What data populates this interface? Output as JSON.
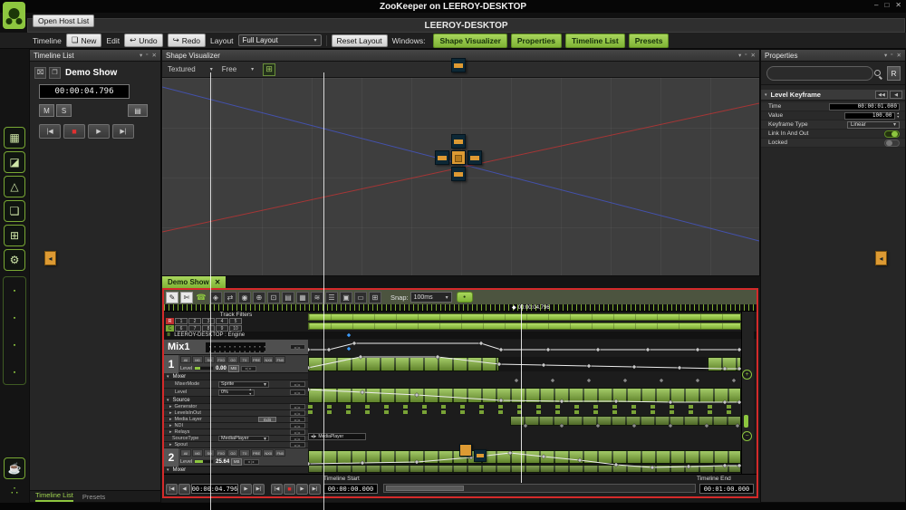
{
  "window": {
    "title": "ZooKeeper on LEEROY-DESKTOP",
    "minimize": "–",
    "maximize": "□",
    "close": "✕"
  },
  "chrome": {
    "menu": "▾",
    "pin": "▫",
    "close": "✕"
  },
  "glyphs": {
    "collapse": "▾",
    "expand": "▸",
    "caret": "▾",
    "diamond": "◆",
    "plus": "+",
    "minus": "−",
    "nav": "◂|▸",
    "engine": "≣",
    "new_doc": "❏",
    "undo": "↩",
    "redo": "↪",
    "grid": "⊞",
    "options": "▤",
    "delete": "⌧",
    "duplicate": "❐",
    "snap_dot": "●",
    "spin_up": "▲",
    "spin_down": "▼",
    "chip_arrow": "◂"
  },
  "host": {
    "open_host_list": "Open Host List",
    "name": "LEEROY-DESKTOP"
  },
  "toolbar": {
    "timeline_menu": "Timeline",
    "new": "New",
    "edit": "Edit",
    "undo": "Undo",
    "redo": "Redo",
    "layout_label": "Layout",
    "layout_value": "Full Layout",
    "reset_layout": "Reset Layout",
    "windows_label": "Windows:",
    "window_buttons": [
      "Shape Visualizer",
      "Properties",
      "Timeline List",
      "Presets"
    ]
  },
  "sidebar": {
    "top_icons": [
      {
        "name": "media-manager-icon",
        "glyph": "▦"
      },
      {
        "name": "output-manager-icon",
        "glyph": "◪"
      },
      {
        "name": "shape-editor-icon",
        "glyph": "△"
      },
      {
        "name": "tags-icon",
        "glyph": "❏"
      },
      {
        "name": "pixelmapper-icon",
        "glyph": "⊞"
      },
      {
        "name": "component-settings-icon",
        "glyph": "⚙"
      }
    ],
    "slots": [
      {
        "glyph": "▪"
      },
      {
        "glyph": "▪"
      },
      {
        "glyph": "▪"
      },
      {
        "glyph": "▪"
      }
    ],
    "cup": "☕",
    "network": "∴"
  },
  "timeline_list": {
    "title": "Timeline List",
    "show_name": "Demo Show",
    "timecode": "00:00:04.796",
    "mute": "M",
    "solo": "S",
    "transport": {
      "skip_back": "|◀",
      "stop": "■",
      "play": "▶",
      "skip_fwd": "▶|"
    },
    "tab_active": "Timeline List",
    "tab_inactive": "Presets"
  },
  "visualizer": {
    "title": "Shape Visualizer",
    "textured": "Textured",
    "free": "Free"
  },
  "properties": {
    "title": "Properties",
    "filter_button": "R",
    "section": "Level Keyframe",
    "nav_prev": "◀◀",
    "nav_next": "◀",
    "time_label": "Time",
    "time_value": "00:00:01.000",
    "value_label": "Value",
    "value_value": "100.00",
    "type_label": "Keyframe Type",
    "type_value": "Linear",
    "link_label": "Link In And Out",
    "link_state": "on",
    "locked_label": "Locked",
    "locked_state": "off"
  },
  "timeline": {
    "tab": "Demo Show",
    "tools": [
      {
        "glyph": "✎",
        "name": "pencil-tool-icon",
        "variant": "lit"
      },
      {
        "glyph": "✄",
        "name": "razor-tool-icon",
        "variant": "lit"
      },
      {
        "glyph": "☎",
        "name": "listen-tool-icon",
        "variant": "green"
      },
      {
        "glyph": "◈",
        "name": "keyframe-tool-icon",
        "variant": ""
      },
      {
        "glyph": "⇄",
        "name": "move-tool-icon",
        "variant": ""
      },
      {
        "glyph": "◉",
        "name": "eye-icon",
        "variant": ""
      },
      {
        "glyph": "⊕",
        "name": "zoom-in-icon",
        "variant": ""
      },
      {
        "glyph": "⊡",
        "name": "zoom-region-icon",
        "variant": ""
      },
      {
        "glyph": "▤",
        "name": "list-view-icon",
        "variant": ""
      },
      {
        "glyph": "▦",
        "name": "grid-view-icon",
        "variant": ""
      },
      {
        "glyph": "≋",
        "name": "curve-editor-icon",
        "variant": ""
      },
      {
        "glyph": "☰",
        "name": "layers-icon",
        "variant": ""
      },
      {
        "glyph": "▣",
        "name": "snapshot-icon",
        "variant": ""
      },
      {
        "glyph": "▭",
        "name": "monitor-icon",
        "variant": ""
      },
      {
        "glyph": "⊞",
        "name": "add-track-icon",
        "variant": ""
      }
    ],
    "snap_label": "Snap:",
    "snap_value": "100ms",
    "playhead_time": "00:00:04.796",
    "track_filters_label": "Track Filters",
    "row_r": "R",
    "row_c": "C",
    "filters_row1": [
      "1",
      "2",
      "3",
      "4",
      "5"
    ],
    "filters_row2": [
      "6",
      "7",
      "8",
      "9",
      "10"
    ],
    "engine_label": "LEEROY-DESKTOP : Engine",
    "mix_name": "Mix1",
    "track_buttons": [
      "All",
      "M0",
      "S0",
      "FX0",
      "G0",
      "T0",
      "PRE",
      "NX0",
      "FN0"
    ],
    "track1_num": "1",
    "track1_level": "0.00",
    "track2_num": "2",
    "track2_level": "25.64",
    "level_label": "Level",
    "mb": "MB",
    "mixer_header": "Mixer",
    "mixer_mode_label": "MixerMode",
    "mixer_mode_value": "Sprite",
    "mixer_level_label": "Level",
    "mixer_level_value": "0%",
    "source_header": "Source",
    "generator": "Generator",
    "levels": "LevelsInOut",
    "media_layer": "Media Layer",
    "edit": "Edit",
    "ndi": "NDI",
    "relays": "Relays",
    "source_type": "SourceType",
    "media_player": "MediaPlayer",
    "spout": "Spout",
    "start_label": "Timeline Start",
    "start_value": "00:00:00.000",
    "end_label": "Timeline End",
    "end_value": "00:01:00.000",
    "t_skip_back": "|◀",
    "t_back": "◀",
    "t_play": "▶",
    "t_fwd": "▶|",
    "t_stop": "■"
  },
  "colors": {
    "accent_green": "#8dc63f",
    "alert_red": "#d42a2a",
    "orange": "#dd9a33"
  }
}
